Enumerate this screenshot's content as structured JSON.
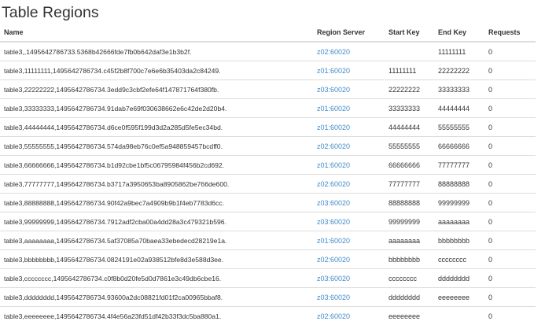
{
  "page": {
    "title": "Table Regions"
  },
  "table": {
    "headers": [
      "Name",
      "Region Server",
      "Start Key",
      "End Key",
      "Requests"
    ],
    "rows": [
      {
        "name": "table3,,1495642786733.5368b42666fde7fb0b642daf3e1b3b2f.",
        "server": "z02:60020",
        "start_key": "",
        "end_key": "11111111",
        "requests": "0"
      },
      {
        "name": "table3,11111111,1495642786734.c45f2b8f700c7e6e6b35403da2c84249.",
        "server": "z01:60020",
        "start_key": "11111111",
        "end_key": "22222222",
        "requests": "0"
      },
      {
        "name": "table3,22222222,1495642786734.3edd9c3cbf2efe64f147871764f380fb.",
        "server": "z03:60020",
        "start_key": "22222222",
        "end_key": "33333333",
        "requests": "0"
      },
      {
        "name": "table3,33333333,1495642786734.91dab7e69f030638662e6c42de2d20b4.",
        "server": "z01:60020",
        "start_key": "33333333",
        "end_key": "44444444",
        "requests": "0"
      },
      {
        "name": "table3,44444444,1495642786734.d6ce0f595f199d3d2a285d5fe5ec34bd.",
        "server": "z01:60020",
        "start_key": "44444444",
        "end_key": "55555555",
        "requests": "0"
      },
      {
        "name": "table3,55555555,1495642786734.574da98eb76c0ef5a948859457bcdff0.",
        "server": "z02:60020",
        "start_key": "55555555",
        "end_key": "66666666",
        "requests": "0"
      },
      {
        "name": "table3,66666666,1495642786734.b1d92cbe1bf5c06795984f456b2cd692.",
        "server": "z01:60020",
        "start_key": "66666666",
        "end_key": "77777777",
        "requests": "0"
      },
      {
        "name": "table3,77777777,1495642786734.b3717a3950653ba8905862be766de600.",
        "server": "z02:60020",
        "start_key": "77777777",
        "end_key": "88888888",
        "requests": "0"
      },
      {
        "name": "table3,88888888,1495642786734.90f42a9bec7a4909b9b1f4eb7783d6cc.",
        "server": "z03:60020",
        "start_key": "88888888",
        "end_key": "99999999",
        "requests": "0"
      },
      {
        "name": "table3,99999999,1495642786734.7912adf2cba00a4dd28a3c479321b596.",
        "server": "z03:60020",
        "start_key": "99999999",
        "end_key": "aaaaaaaa",
        "requests": "0"
      },
      {
        "name": "table3,aaaaaaaa,1495642786734.5af37085a70baea33ebedecd28219e1a.",
        "server": "z01:60020",
        "start_key": "aaaaaaaa",
        "end_key": "bbbbbbbb",
        "requests": "0"
      },
      {
        "name": "table3,bbbbbbbb,1495642786734.0824191e02a938512bfe8d3e588d3ee.",
        "server": "z02:60020",
        "start_key": "bbbbbbbb",
        "end_key": "cccccccc",
        "requests": "0"
      },
      {
        "name": "table3,cccccccc,1495642786734.c0f8b0d20fe5d0d7861e3c49db6cbe16.",
        "server": "z03:60020",
        "start_key": "cccccccc",
        "end_key": "dddddddd",
        "requests": "0"
      },
      {
        "name": "table3,dddddddd,1495642786734.93600a2dc08821fd01f2ca00965bbaf8.",
        "server": "z03:60020",
        "start_key": "dddddddd",
        "end_key": "eeeeeeee",
        "requests": "0"
      },
      {
        "name": "table3,eeeeeeee,1495642786734.4f4e56a23fd51df42b33f3dc5ba880a1.",
        "server": "z02:60020",
        "start_key": "eeeeeeee",
        "end_key": "",
        "requests": "0"
      }
    ]
  },
  "colors": {
    "link": "#428bca",
    "text": "#333333",
    "border": "#dddddd"
  }
}
